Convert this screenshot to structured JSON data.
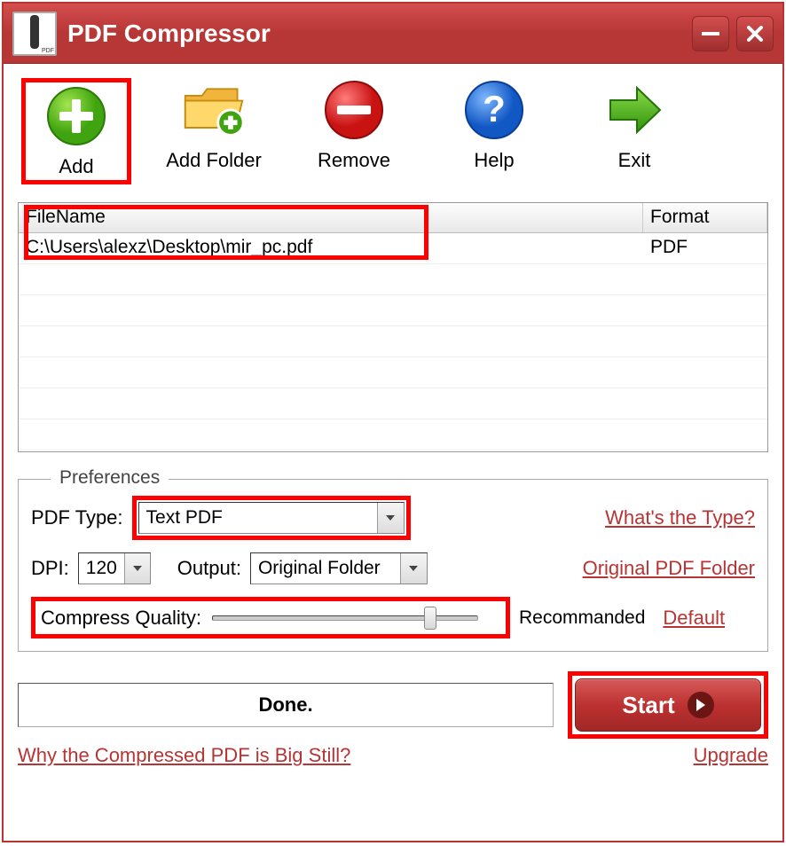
{
  "title": "PDF Compressor",
  "toolbar": {
    "add": "Add",
    "add_folder": "Add Folder",
    "remove": "Remove",
    "help": "Help",
    "exit": "Exit"
  },
  "table": {
    "headers": {
      "filename": "FileName",
      "format": "Format"
    },
    "rows": [
      {
        "path": "C:\\Users\\alexz\\Desktop\\mir_pc.pdf",
        "format": "PDF"
      }
    ]
  },
  "prefs": {
    "legend": "Preferences",
    "pdf_type_label": "PDF Type:",
    "pdf_type_value": "Text PDF",
    "whats_type": "What's the Type?",
    "dpi_label": "DPI:",
    "dpi_value": "120",
    "output_label": "Output:",
    "output_value": "Original Folder",
    "orig_folder_link": "Original PDF Folder",
    "quality_label": "Compress Quality:",
    "recommended": "Recommanded",
    "default_link": "Default"
  },
  "status": "Done.",
  "start": "Start",
  "bottom": {
    "why_big": "Why the Compressed PDF is Big Still?",
    "upgrade": "Upgrade"
  }
}
